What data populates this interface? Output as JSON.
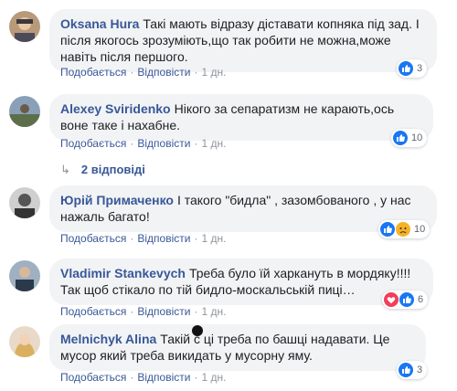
{
  "labels": {
    "like": "Подобається",
    "reply": "Відповісти",
    "sep": "·"
  },
  "comments": [
    {
      "author": "Oksana Hura",
      "text": "Такі мають відразу діставати копняка під зад. І після якогось зрозуміють,що так робити не можна,може навіть після першого.",
      "time": "1 дн.",
      "reactions": {
        "icons": [
          "like-icon"
        ],
        "count": "3"
      }
    },
    {
      "author": "Alexey Sviridenko",
      "text": "Нікого за сепаратизм не карають,ось воне таке і нахабне.",
      "time": "1 дн.",
      "reactions": {
        "icons": [
          "like-icon"
        ],
        "count": "10"
      }
    },
    {
      "author": "Юрій Примаченко",
      "text": "І такого \"бидла\" , зазомбованого , у нас нажаль багато!",
      "time": "1 дн.",
      "reactions": {
        "icons": [
          "like-icon",
          "sad-icon"
        ],
        "count": "10"
      }
    },
    {
      "author": "Vladimir Stankevych",
      "text": "Треба було їй харкануть в мордяку!!!! Так щоб стікало по тій бидло-москальській пиці…",
      "time": "1 дн.",
      "reactions": {
        "icons": [
          "love-icon",
          "like-icon"
        ],
        "count": "6"
      }
    },
    {
      "author": "Melnichyk Alina",
      "text": "Такій с   ці треба по башці надавати. Це мусор який треба викидать у мусорну яму.",
      "time": "1 дн.",
      "reactions": {
        "icons": [
          "like-icon"
        ],
        "count": "3"
      }
    }
  ],
  "replies_link": "2 відповіді",
  "colors": {
    "link": "#385898",
    "bubble": "#f2f3f5",
    "like": "#1877f2",
    "love": "#f33e58",
    "sad": "#f7b125"
  }
}
